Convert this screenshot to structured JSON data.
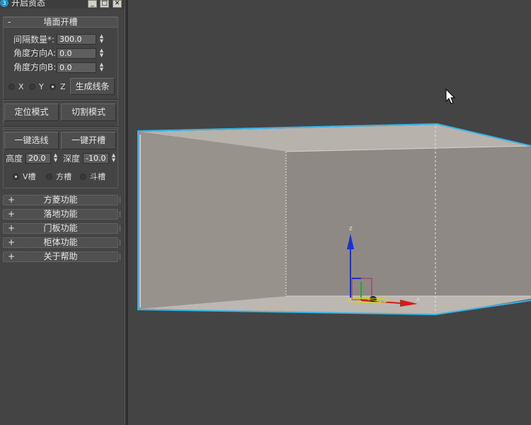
{
  "window": {
    "title": "开启资态"
  },
  "wall_slot": {
    "header_sign": "-",
    "header_label": "墙面开槽",
    "spacing_label": "间隔数量*:",
    "spacing_value": "300.0",
    "angle_a_label": "角度方向A:",
    "angle_a_value": "0.0",
    "angle_b_label": "角度方向B:",
    "angle_b_value": "0.0",
    "axis_x": "X",
    "axis_y": "Y",
    "axis_z": "Z",
    "axis_selected": "Z",
    "generate_lines_btn": "生成线条",
    "locate_mode_btn": "定位模式",
    "cut_mode_btn": "切割模式",
    "select_lines_btn": "一键选线",
    "open_slot_btn": "一键开槽",
    "height_label": "高度",
    "height_value": "20.0",
    "depth_label": "深度",
    "depth_value": "-10.0",
    "slot_v": "V槽",
    "slot_square": "方槽",
    "slot_bucket": "斗槽",
    "slot_selected": "V槽"
  },
  "rollouts": [
    {
      "sign": "+",
      "label": "方菱功能"
    },
    {
      "sign": "+",
      "label": "落地功能"
    },
    {
      "sign": "+",
      "label": "门板功能"
    },
    {
      "sign": "+",
      "label": "柜体功能"
    },
    {
      "sign": "+",
      "label": "关于帮助"
    }
  ],
  "gizmo": {
    "axis_z": "z",
    "axis_x": "x"
  },
  "colors": {
    "viewport_bg": "#444444",
    "selection_outline": "#37b6ea",
    "box_fill": "#8f8a86",
    "gizmo_z": "#1b2fd6",
    "gizmo_x": "#d61b1b",
    "gizmo_y": "#1bb01b"
  },
  "icons": {
    "title_logo": "3ds-max-logo-icon",
    "cursor": "mouse-pointer-icon"
  }
}
